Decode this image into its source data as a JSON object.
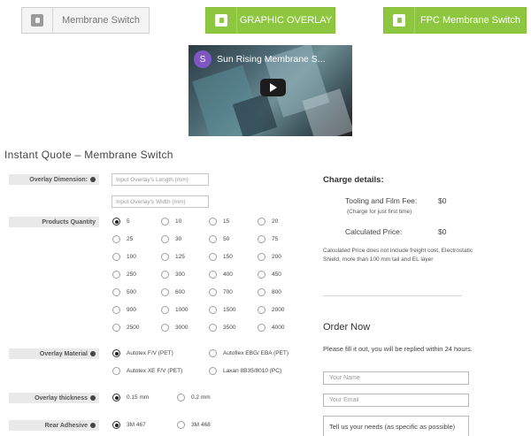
{
  "tabs": {
    "membrane_switch": "Membrane Switch",
    "graphic_overlay": "GRAPHIC OVERLAY",
    "fpc": "FPC Membrane Switch"
  },
  "video": {
    "channel_initial": "S",
    "title": "Sun Rising Membrane S..."
  },
  "quote": {
    "heading": "Instant Quote – Membrane Switch",
    "overlay_dimension": {
      "label": "Overlay Dimension:",
      "length_placeholder": "Input Overlay's Length (mm)",
      "width_placeholder": "Input Overlay's Width (mm)"
    },
    "products_quantity": {
      "label": "Products Quantity",
      "selected": "5",
      "options": [
        "5",
        "10",
        "15",
        "20",
        "25",
        "30",
        "50",
        "75",
        "100",
        "125",
        "150",
        "200",
        "250",
        "300",
        "400",
        "450",
        "500",
        "600",
        "700",
        "800",
        "900",
        "1000",
        "1500",
        "2000",
        "2500",
        "3000",
        "3500",
        "4000"
      ]
    },
    "overlay_material": {
      "label": "Overlay Material",
      "selected": "Autotex F/V (PET)",
      "options": [
        "Autotex F/V (PET)",
        "Autoflex EBG/ EBA (PET)",
        "Autotex XE F/V (PET)",
        "Laxan 8B35/8010 (PC)"
      ]
    },
    "overlay_thickness": {
      "label": "Overlay thickness",
      "selected": "0.15 mm",
      "options": [
        "0.15 mm",
        "0.2 mm"
      ]
    },
    "rear_adhesive": {
      "label": "Rear Adhesive",
      "selected": "3M 467",
      "options": [
        "3M 467",
        "3M 468"
      ]
    }
  },
  "charge": {
    "title": "Charge details:",
    "tooling_label": "Tooling and Film Fee:",
    "tooling_value": "$0",
    "tooling_note": "(Charge for just first time)",
    "calculated_label": "Calculated Price:",
    "calculated_value": "$0",
    "disclaimer": "Calculated Price does not include freight cost, Electrostatic Shield, more than 100 mm tail and EL layer"
  },
  "order": {
    "title": "Order Now",
    "note": "Please fill it out, you will be replied within 24 hours.",
    "name_placeholder": "Your Name",
    "email_placeholder": "Your Email",
    "needs_placeholder": "Tell us your needs (as specific as possible)"
  },
  "colors": {
    "accent_green": "#8dc63f",
    "label_bar": "#e9e9e9",
    "avatar_purple": "#7e57c2"
  }
}
